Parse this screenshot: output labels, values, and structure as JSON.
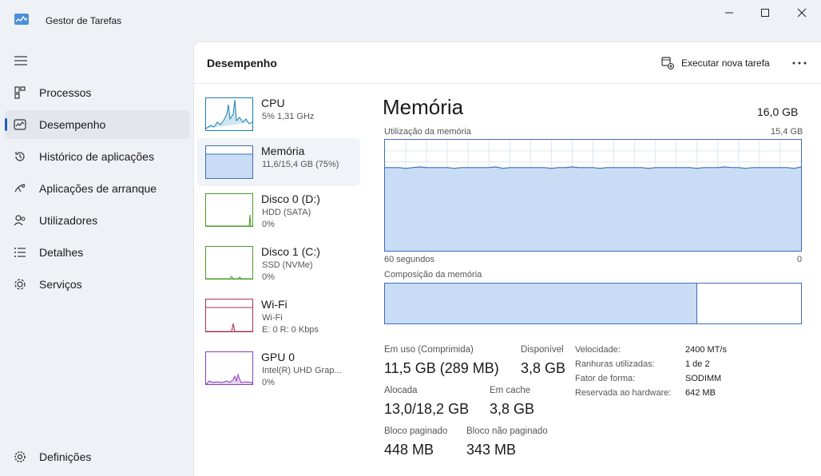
{
  "window": {
    "title": "Gestor de Tarefas",
    "controls": [
      "minimize-icon",
      "maximize-icon",
      "close-icon"
    ]
  },
  "sidebar": {
    "items": [
      {
        "label": "Processos",
        "icon": "processes-icon",
        "active": false
      },
      {
        "label": "Desempenho",
        "icon": "performance-icon",
        "active": true
      },
      {
        "label": "Histórico de aplicações",
        "icon": "history-icon",
        "active": false
      },
      {
        "label": "Aplicações de arranque",
        "icon": "startup-icon",
        "active": false
      },
      {
        "label": "Utilizadores",
        "icon": "users-icon",
        "active": false
      },
      {
        "label": "Detalhes",
        "icon": "details-icon",
        "active": false
      },
      {
        "label": "Serviços",
        "icon": "services-icon",
        "active": false
      }
    ],
    "settings_label": "Definições"
  },
  "header": {
    "title": "Desempenho",
    "run_task_label": "Executar nova tarefa"
  },
  "devices": [
    {
      "name": "CPU",
      "sub": "5%  1,31 GHz",
      "sub2": "",
      "color": "#1a7fb5"
    },
    {
      "name": "Memória",
      "sub": "11,6/15,4 GB (75%)",
      "sub2": "",
      "color": "#3d6fb5"
    },
    {
      "name": "Disco 0 (D:)",
      "sub": "HDD (SATA)",
      "sub2": "0%",
      "color": "#4c9a2a"
    },
    {
      "name": "Disco 1 (C:)",
      "sub": "SSD (NVMe)",
      "sub2": "0%",
      "color": "#4c9a2a"
    },
    {
      "name": "Wi-Fi",
      "sub": "Wi-Fi",
      "sub2": "E: 0 R: 0 Kbps",
      "color": "#a7325b"
    },
    {
      "name": "GPU 0",
      "sub": "Intel(R) UHD Grap...",
      "sub2": "0%",
      "color": "#8a3fb8"
    }
  ],
  "memory": {
    "title": "Memória",
    "total": "16,0 GB",
    "usage_label": "Utilização da memória",
    "usage_max": "15,4 GB",
    "time_left": "60 segundos",
    "time_right": "0",
    "composition_label": "Composição da memória",
    "usage_fraction": 0.75,
    "composition_in_use_fraction": 0.75,
    "stats": {
      "in_use_label": "Em uso (Comprimida)",
      "in_use_value": "11,5 GB (289 MB)",
      "available_label": "Disponível",
      "available_value": "3,8 GB",
      "committed_label": "Alocada",
      "committed_value": "13,0/18,2 GB",
      "cached_label": "Em cache",
      "cached_value": "3,8 GB",
      "paged_label": "Bloco paginado",
      "paged_value": "448 MB",
      "nonpaged_label": "Bloco não paginado",
      "nonpaged_value": "343 MB"
    },
    "specs": [
      {
        "label": "Velocidade:",
        "value": "2400 MT/s"
      },
      {
        "label": "Ranhuras utilizadas:",
        "value": "1 de 2"
      },
      {
        "label": "Fator de forma:",
        "value": "SODIMM"
      },
      {
        "label": "Reservada ao hardware:",
        "value": "642 MB"
      }
    ]
  },
  "colors": {
    "accent": "#1f5fbf",
    "memory_line": "#3d6fb5",
    "memory_fill": "#c8dcf6"
  }
}
